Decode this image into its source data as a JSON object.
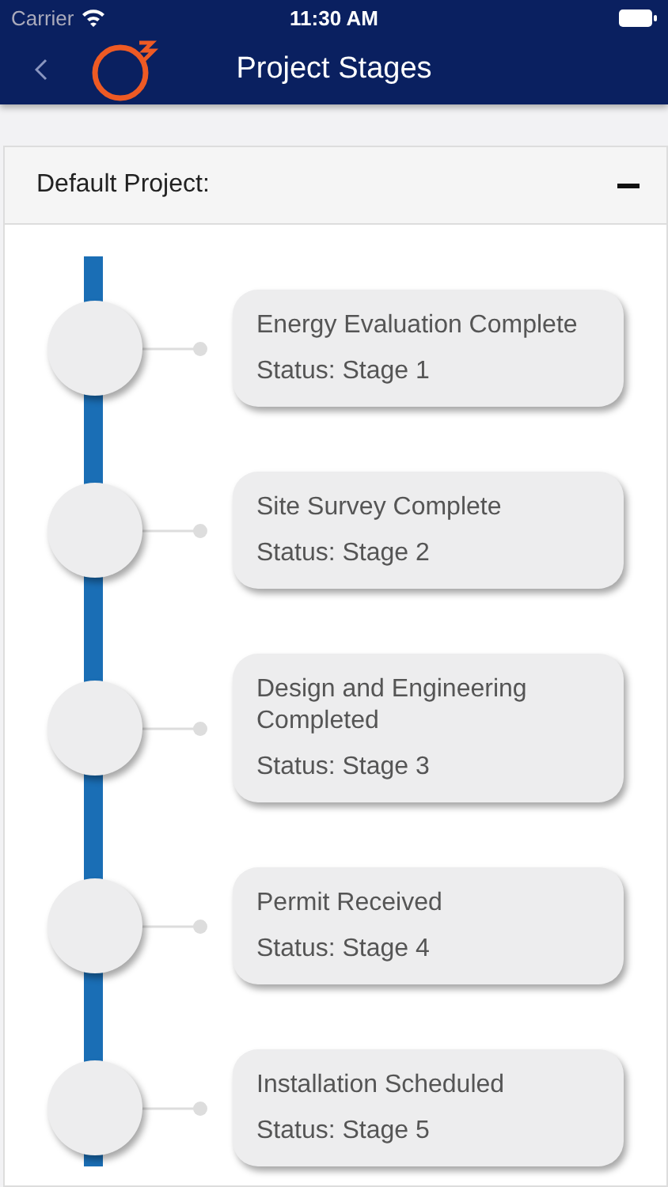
{
  "status_bar": {
    "carrier": "Carrier",
    "time": "11:30 AM"
  },
  "nav": {
    "title": "Project Stages"
  },
  "project": {
    "name": "Default Project:",
    "expanded": true,
    "stages": [
      {
        "title": "Energy Evaluation Complete",
        "status": "Status: Stage 1"
      },
      {
        "title": "Site Survey Complete",
        "status": "Status: Stage 2"
      },
      {
        "title": "Design and Engineering Completed",
        "status": "Status: Stage 3"
      },
      {
        "title": "Permit Received",
        "status": "Status: Stage 4"
      },
      {
        "title": "Installation Scheduled",
        "status": "Status: Stage 5"
      }
    ]
  }
}
